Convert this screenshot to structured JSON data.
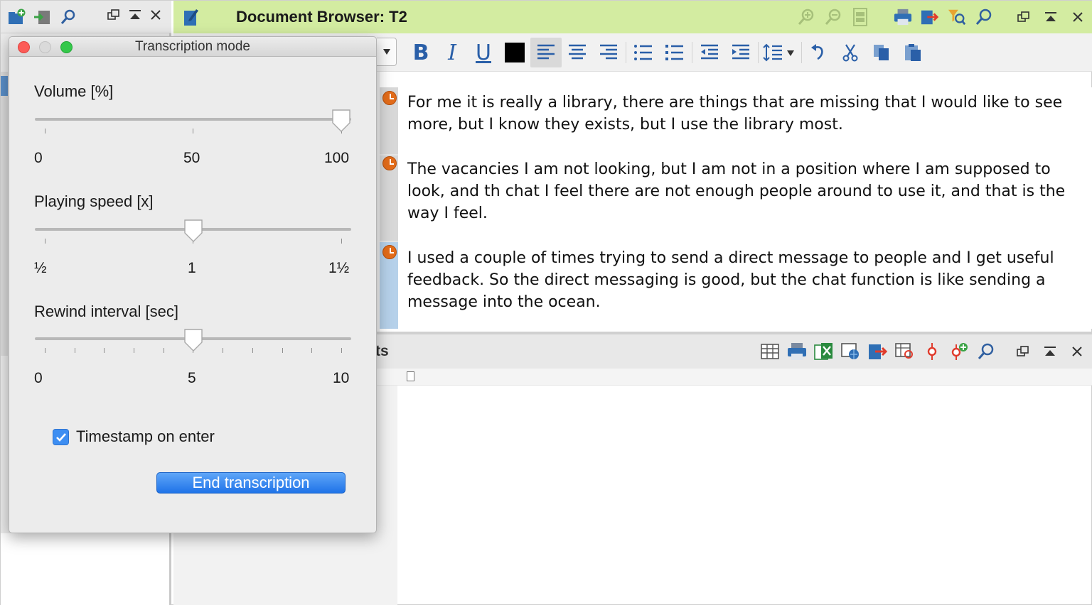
{
  "document_browser": {
    "title": "Document Browser: T2",
    "paragraphs": [
      "For me it is really a library, there are things that are missing that I would like to see more, but I know they exists, but I use the library most.",
      "The vacancies I am not looking, but I am not in a position where I am supposed to look, and th chat I feel there are not enough people around to use it, and that is the way I feel.",
      "I used a couple of times trying to send a direct message to people and I get useful feedback. So the direct messaging is good, but the chat function is like sending a message into the ocean."
    ],
    "format_toolbar": {
      "bold": "B",
      "italic": "I",
      "underline": "U"
    }
  },
  "second_pane": {
    "title_fragment": "ts"
  },
  "transcription_dialog": {
    "title": "Transcription mode",
    "volume": {
      "label": "Volume [%]",
      "value": 100,
      "scale": [
        "0",
        "50",
        "100"
      ]
    },
    "speed": {
      "label": "Playing speed [x]",
      "value": 1,
      "scale": [
        "½",
        "1",
        "1½"
      ]
    },
    "rewind": {
      "label": "Rewind interval [sec]",
      "value": 5,
      "scale": [
        "0",
        "5",
        "10"
      ]
    },
    "timestamp_on_enter": {
      "label": "Timestamp on enter",
      "checked": true
    },
    "end_button": "End transcription"
  },
  "colors": {
    "header_green": "#d3eca1",
    "accent_blue": "#2a5fa8",
    "button_blue": "#1f73e8",
    "clock_orange": "#e36c1a"
  }
}
